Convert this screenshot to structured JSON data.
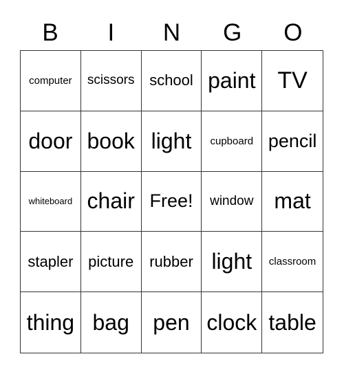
{
  "header": [
    "B",
    "I",
    "N",
    "G",
    "O"
  ],
  "cells": [
    "computer",
    "scissors",
    "school",
    "paint",
    "TV",
    "door",
    "book",
    "light",
    "cupboard",
    "pencil",
    "whiteboard",
    "chair",
    "Free!",
    "window",
    "mat",
    "stapler",
    "picture",
    "rubber",
    "light",
    "classroom",
    "thing",
    "bag",
    "pen",
    "clock",
    "table"
  ]
}
